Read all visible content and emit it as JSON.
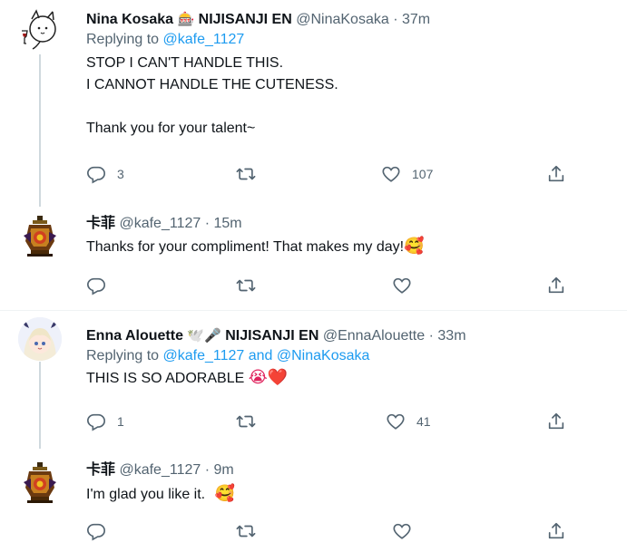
{
  "tweets": [
    {
      "name": "Nina Kosaka",
      "name_emoji": "🎰",
      "affiliation": "NIJISANJI EN",
      "handle": "@NinaKosaka",
      "sep": "·",
      "time": "37m",
      "replying_prefix": "Replying to",
      "replying_to": "@kafe_1127",
      "lines": [
        "STOP I CAN'T HANDLE THIS.",
        "I CANNOT HANDLE THE CUTENESS.",
        "",
        "Thank you for your talent~"
      ],
      "replies": "3",
      "retweets": "",
      "likes": "107"
    },
    {
      "name": "卡菲",
      "handle": "@kafe_1127",
      "sep": "·",
      "time": "15m",
      "text": "Thanks for your compliment! That makes my day!",
      "text_emoji": "🥰",
      "replies": "",
      "retweets": "",
      "likes": ""
    },
    {
      "name": "Enna Alouette",
      "name_emoji": "🕊️🎤",
      "affiliation": "NIJISANJI EN",
      "handle": "@EnnaAlouette",
      "sep": "·",
      "time": "33m",
      "replying_prefix": "Replying to",
      "replying_to": "@kafe_1127 and @NinaKosaka",
      "text": "THIS IS SO ADORABLE",
      "text_emoji": "😭❤️",
      "replies": "1",
      "retweets": "",
      "likes": "41"
    },
    {
      "name": "卡菲",
      "handle": "@kafe_1127",
      "sep": "·",
      "time": "9m",
      "text": "I'm glad you like it.",
      "text_emoji": "🥰",
      "replies": "",
      "retweets": "",
      "likes": ""
    }
  ],
  "icons": {
    "reply": "reply-icon",
    "retweet": "retweet-icon",
    "like": "like-icon",
    "share": "share-icon"
  },
  "colors": {
    "link": "#1d9bf0",
    "muted": "#536471",
    "thread_line": "#cfd9de",
    "divider": "#eff3f4"
  }
}
